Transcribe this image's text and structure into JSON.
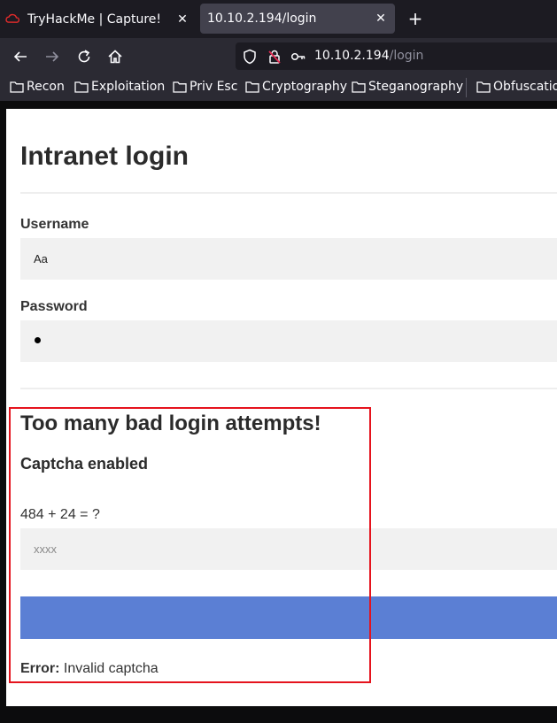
{
  "browser": {
    "tabs": [
      {
        "title": "TryHackMe | Capture!",
        "active": false
      },
      {
        "title": "10.10.2.194/login",
        "active": true
      }
    ],
    "url": {
      "host": "10.10.2.194",
      "path": "/login"
    },
    "bookmarks": [
      "Recon",
      "Exploitation",
      "Priv Esc",
      "Cryptography",
      "Steganography",
      "Obfuscation"
    ]
  },
  "page": {
    "title": "Intranet login",
    "username_label": "Username",
    "username_value": "Aa",
    "password_label": "Password",
    "password_value": "•",
    "warning_title": "Too many bad login attempts!",
    "captcha_title": "Captcha enabled",
    "captcha_question": "484 + 24 = ?",
    "captcha_placeholder": "xxxx",
    "submit_label": "",
    "error_prefix": "Error:",
    "error_message": "Invalid captcha"
  },
  "colors": {
    "submit_button": "#5b7fd4",
    "highlight_box": "#e5131d"
  }
}
